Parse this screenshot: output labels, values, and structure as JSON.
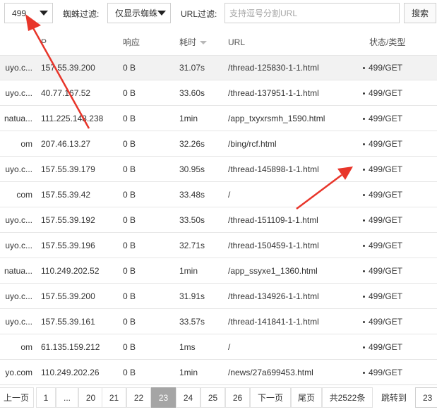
{
  "toolbar": {
    "status_select_value": "499",
    "spider_label": "蜘蛛过滤:",
    "spider_select_value": "仅显示蜘蛛",
    "url_label": "URL过滤:",
    "url_placeholder": "支持逗号分割URL",
    "search_label": "搜索"
  },
  "table": {
    "headers": {
      "host": "",
      "ip": "P",
      "response": "响应",
      "time": "耗时",
      "url": "URL",
      "status": "状态/类型"
    },
    "rows": [
      {
        "host": "uyo.c...",
        "ip": "157.55.39.200",
        "response": "0 B",
        "time": "31.07s",
        "url": "/thread-125830-1-1.html",
        "status": "499/GET",
        "highlight": true
      },
      {
        "host": "uyo.c...",
        "ip": "40.77.167.52",
        "response": "0 B",
        "time": "33.60s",
        "url": "/thread-137951-1-1.html",
        "status": "499/GET",
        "highlight": false
      },
      {
        "host": "natua...",
        "ip": "111.225.148.238",
        "response": "0 B",
        "time": "1min",
        "url": "/app_txyxrsmh_1590.html",
        "status": "499/GET",
        "highlight": false
      },
      {
        "host": "om",
        "ip": "207.46.13.27",
        "response": "0 B",
        "time": "32.26s",
        "url": "/bing/rcf.html",
        "status": "499/GET",
        "highlight": false
      },
      {
        "host": "uyo.c...",
        "ip": "157.55.39.179",
        "response": "0 B",
        "time": "30.95s",
        "url": "/thread-145898-1-1.html",
        "status": "499/GET",
        "highlight": false
      },
      {
        "host": "com",
        "ip": "157.55.39.42",
        "response": "0 B",
        "time": "33.48s",
        "url": "/",
        "status": "499/GET",
        "highlight": false
      },
      {
        "host": "uyo.c...",
        "ip": "157.55.39.192",
        "response": "0 B",
        "time": "33.50s",
        "url": "/thread-151109-1-1.html",
        "status": "499/GET",
        "highlight": false
      },
      {
        "host": "uyo.c...",
        "ip": "157.55.39.196",
        "response": "0 B",
        "time": "32.71s",
        "url": "/thread-150459-1-1.html",
        "status": "499/GET",
        "highlight": false
      },
      {
        "host": "natua...",
        "ip": "110.249.202.52",
        "response": "0 B",
        "time": "1min",
        "url": "/app_ssyxe1_1360.html",
        "status": "499/GET",
        "highlight": false
      },
      {
        "host": "uyo.c...",
        "ip": "157.55.39.200",
        "response": "0 B",
        "time": "31.91s",
        "url": "/thread-134926-1-1.html",
        "status": "499/GET",
        "highlight": false
      },
      {
        "host": "uyo.c...",
        "ip": "157.55.39.161",
        "response": "0 B",
        "time": "33.57s",
        "url": "/thread-141841-1-1.html",
        "status": "499/GET",
        "highlight": false
      },
      {
        "host": "om",
        "ip": "61.135.159.212",
        "response": "0 B",
        "time": "1ms",
        "url": "/",
        "status": "499/GET",
        "highlight": false
      },
      {
        "host": "yo.com",
        "ip": "110.249.202.26",
        "response": "0 B",
        "time": "1min",
        "url": "/news/27a699453.html",
        "status": "499/GET",
        "highlight": false
      }
    ]
  },
  "pagination": {
    "prev": "上一页",
    "first": "1",
    "ellipsis": "...",
    "pages": [
      "20",
      "21",
      "22",
      "23",
      "24",
      "25",
      "26"
    ],
    "current": "23",
    "next": "下一页",
    "last": "尾页",
    "total": "共2522条",
    "jump_label": "跳转到",
    "jump_value": "23"
  },
  "colors": {
    "annotation_arrow": "#e8352a",
    "active_page": "#a5a5a5",
    "highlight_row": "#f2f2f2"
  }
}
